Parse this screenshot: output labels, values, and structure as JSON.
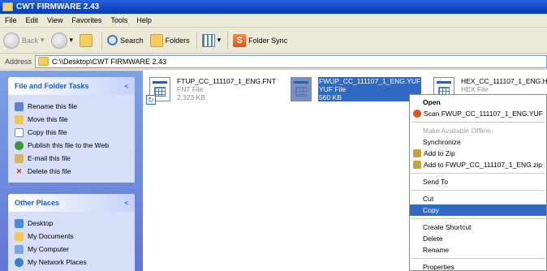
{
  "window": {
    "title": "CWT FIRMWARE 2.43"
  },
  "menu": [
    "File",
    "Edit",
    "View",
    "Favorites",
    "Tools",
    "Help"
  ],
  "toolbar": {
    "back": "Back",
    "search": "Search",
    "folders": "Folders",
    "folder_sync": "Folder Sync"
  },
  "address": {
    "label": "Address",
    "path": "C:\\\\Desktop\\CWT FIRMWARE 2.43"
  },
  "file_tasks": {
    "title": "File and Folder Tasks",
    "items": [
      "Rename this file",
      "Move this file",
      "Copy this file",
      "Publish this file to the Web",
      "E-mail this file",
      "Delete this file"
    ]
  },
  "other_places": {
    "title": "Other Places",
    "items": [
      "Desktop",
      "My Documents",
      "My Computer",
      "My Network Places"
    ]
  },
  "files": [
    {
      "name": "FTUP_CC_111107_1_ENG.FNT",
      "type": "FNT File",
      "size": "2,323 KB"
    },
    {
      "name": "FWUP_CC_111107_1_ENG.YUF",
      "type": "YUF File",
      "size": "560 KB"
    },
    {
      "name": "HEX_CC_111107_1_ENG.H",
      "type": "HEX File",
      "size": ""
    }
  ],
  "context_menu": {
    "open": "Open",
    "scan": "Scan FWUP_CC_111107_1_ENG.YUF",
    "offline": "Make Available Offline",
    "sync": "Synchronize",
    "add_zip": "Add to Zip",
    "add_named_zip": "Add to FWUP_CC_111107_1_ENG.zip",
    "send_to": "Send To",
    "cut": "Cut",
    "copy": "Copy",
    "shortcut": "Create Shortcut",
    "delete": "Delete",
    "rename": "Rename",
    "properties": "Properties"
  },
  "colors": {
    "selection": "#316ac5",
    "titlebar": "#0b47c8",
    "taskpane": "#7ba2e7"
  }
}
